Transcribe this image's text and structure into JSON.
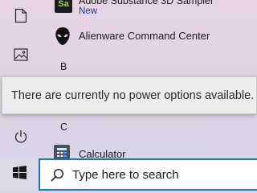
{
  "start_menu": {
    "apps": {
      "substance": {
        "name": "Adobe Substance 3D Sampler",
        "badge": "New",
        "tile_letters": "Sa"
      },
      "alienware": {
        "name": "Alienware Command Center"
      },
      "section_b": "B",
      "section_c": "C",
      "calculator": {
        "name": "Calculator"
      }
    }
  },
  "tooltip": {
    "text": "There are currently no power options available."
  },
  "taskbar": {
    "search": {
      "placeholder": "Type here to search"
    }
  },
  "colors": {
    "accent": "#1e6fd0",
    "substance_tile_bg": "#1c1c1c",
    "substance_tile_fg": "#9bd35a",
    "calculator_tile_bg": "#4a4f5a"
  }
}
